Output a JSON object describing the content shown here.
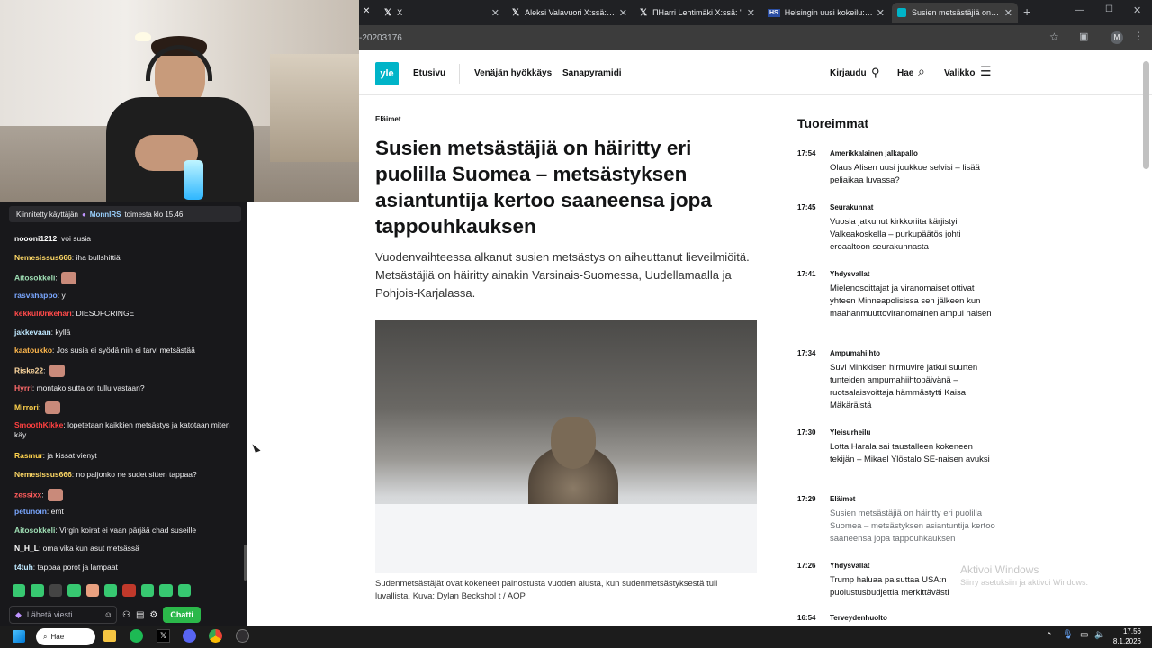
{
  "browser": {
    "tabs": [
      {
        "title": "X",
        "active": false
      },
      {
        "title": "Aleksi Valavuori X:ssä: \"Esit",
        "active": false
      },
      {
        "title": "ПHarri Lehtimäki X:ssä: \"",
        "active": false
      },
      {
        "title": "Helsingin uusi kokeilu: Alfa",
        "active": false
      },
      {
        "title": "Susien metsästäjiä on häiri",
        "active": true
      }
    ],
    "new_tab": "+",
    "address": "-20203176",
    "profile_initial": "M"
  },
  "chat": {
    "pinned": {
      "prefix": "Kiinnitetty käyttäjän",
      "user": "MonnIRS",
      "suffix": "toimesta klo 15.46"
    },
    "messages": [
      {
        "user": "noooni1212",
        "color": "#ffffff",
        "text": "voi susia"
      },
      {
        "user": "Nemesissus666",
        "color": "#ffd966",
        "text": "iha bullshittiä"
      },
      {
        "user": "Aitosokkeli",
        "color": "#9fdfb5",
        "text": ""
      },
      {
        "user": "rasvahappo",
        "color": "#7aa7ff",
        "text": "y"
      },
      {
        "user": "kekkuli0nkehari",
        "color": "#ff4a4a",
        "text": "DIESOFCRINGE"
      },
      {
        "user": "jakkevaan",
        "color": "#bfe8ff",
        "text": "kyllä"
      },
      {
        "user": "kaatoukko",
        "color": "#ffb84d",
        "text": "Jos susia ei syödä niin ei tarvi metsästää"
      },
      {
        "user": "Riske22",
        "color": "#ffd9a0",
        "text": ""
      },
      {
        "user": "Hyrri",
        "color": "#ff6b6b",
        "text": "montako sutta on tullu vastaan?"
      },
      {
        "user": "Mirrori",
        "color": "#ffd24d",
        "text": ""
      },
      {
        "user": "SmoothKikke",
        "color": "#ff4040",
        "text": "lopetetaan kaikkien metsästys ja katotaan miten käy"
      },
      {
        "user": "Rasmur",
        "color": "#ffd24d",
        "text": "ja kissat vienyt"
      },
      {
        "user": "Nemesissus666",
        "color": "#ffd966",
        "text": "no paljonko ne sudet sitten tappaa?"
      },
      {
        "user": "zessixx",
        "color": "#ff5c5c",
        "text": ""
      },
      {
        "user": "petunoin",
        "color": "#7aa7ff",
        "text": "emt"
      },
      {
        "user": "Aitosokkeli",
        "color": "#9fdfb5",
        "text": "Virgin koirat ei vaan pärjää chad suseille"
      },
      {
        "user": "N_H_L",
        "color": "#ffffff",
        "text": "oma vika kun asut metsässä"
      },
      {
        "user": "t4tuh",
        "color": "#bfe8ff",
        "text": "tappaa porot ja lampaat"
      }
    ],
    "input_placeholder": "Lähetä viesti",
    "send_label": "Chatti"
  },
  "yle": {
    "logo": "yle",
    "nav": [
      "Etusivu",
      "Venäjän hyökkäys",
      "Sanapyramidi"
    ],
    "login": "Kirjaudu",
    "search": "Hae",
    "menu": "Valikko",
    "category": "Eläimet",
    "headline": "Susien metsästäjiä on häiritty eri puolilla Suomea – metsästyksen asiantuntija kertoo saaneensa jopa tappouhkauksen",
    "lead": "Vuodenvaihteessa alkanut susien metsästys on aiheuttanut lieveilmiöitä. Metsästäjiä on häiritty ainakin Varsinais-Suomessa, Uudellamaalla ja Pohjois-Karjalassa.",
    "caption": "Sudenmetsästäjät ovat kokeneet painostusta vuoden alusta, kun sudenmetsästyksestä tuli luvallista. Kuva: Dylan Beckshol t / AOP",
    "latest_title": "Tuoreimmat",
    "latest": [
      {
        "time": "17:54",
        "cat": "Amerikkalainen jalkapallo",
        "title": "Olaus Alisen uusi joukkue selvisi – lisää peliaikaa luvassa?",
        "current": false
      },
      {
        "time": "17:45",
        "cat": "Seurakunnat",
        "title": "Vuosia jatkunut kirkkoriita kärjistyi Valkeakoskella – purkupäätös johti eroaaltoon seurakunnasta",
        "current": false
      },
      {
        "time": "17:41",
        "cat": "Yhdysvallat",
        "title": "Mielenosoittajat ja viranomaiset ottivat yhteen Minneapolisissa sen jälkeen kun maahanmuuttoviranomainen ampui naisen",
        "current": false
      },
      {
        "time": "17:34",
        "cat": "Ampumahiihto",
        "title": "Suvi Minkkisen hirmuvire jatkui suurten tunteiden ampumahiihtopäivänä – ruotsalaisvoittaja hämmästytti Kaisa Mäkäräistä",
        "current": false
      },
      {
        "time": "17:30",
        "cat": "Yleisurheilu",
        "title": "Lotta Harala sai taustalleen kokeneen tekijän – Mikael Ylöstalo SE-naisen avuksi",
        "current": false
      },
      {
        "time": "17:29",
        "cat": "Eläimet",
        "title": "Susien metsästäjiä on häiritty eri puolilla Suomea – metsästyksen asiantuntija kertoo saaneensa jopa tappouhkauksen",
        "current": true
      },
      {
        "time": "17:26",
        "cat": "Yhdysvallat",
        "title": "Trump haluaa paisuttaa USA:n puolustusbudjettia merkittävästi",
        "current": false
      },
      {
        "time": "16:54",
        "cat": "Terveydenhuolto",
        "title": "",
        "current": false
      }
    ]
  },
  "windows": {
    "activate_title": "Aktivoi Windows",
    "activate_sub": "Siirry asetuksiin ja aktivoi Windows.",
    "search_label": "Hae",
    "clock_time": "17.56",
    "clock_date": "8.1.2026"
  }
}
